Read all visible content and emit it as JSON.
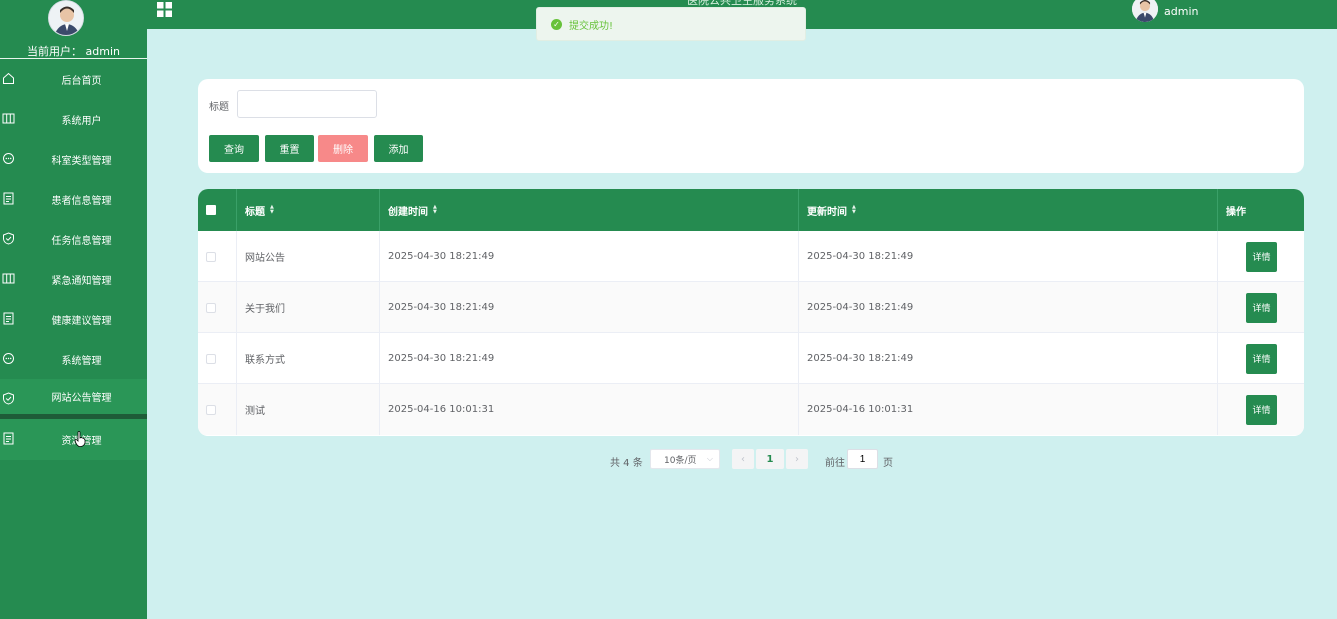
{
  "sidebar": {
    "current_user": "当前用户：  admin",
    "items": [
      {
        "label": "后台首页",
        "icon": "home-icon"
      },
      {
        "label": "系统用户",
        "icon": "columns-icon"
      },
      {
        "label": "科室类型管理",
        "icon": "chat-bubble-icon"
      },
      {
        "label": "患者信息管理",
        "icon": "document-icon"
      },
      {
        "label": "任务信息管理",
        "icon": "shield-icon"
      },
      {
        "label": "紧急通知管理",
        "icon": "columns-icon"
      },
      {
        "label": "健康建议管理",
        "icon": "document-icon"
      },
      {
        "label": "系统管理",
        "icon": "chat-bubble-icon"
      },
      {
        "label": "网站公告管理",
        "icon": "shield-icon"
      },
      {
        "label": "资源管理",
        "icon": "document-icon"
      }
    ]
  },
  "header": {
    "title": "医院公共卫生服务系统",
    "username": "admin"
  },
  "toast": {
    "message": "提交成功!"
  },
  "search": {
    "title_label": "标题",
    "title_value": "",
    "buttons": {
      "query": "查询",
      "reset": "重置",
      "delete": "删除",
      "add": "添加"
    }
  },
  "table": {
    "headers": {
      "title": "标题",
      "created": "创建时间",
      "updated": "更新时间",
      "actions": "操作"
    },
    "detail_label": "详情",
    "rows": [
      {
        "title": "网站公告",
        "created": "2025-04-30 18:21:49",
        "updated": "2025-04-30 18:21:49"
      },
      {
        "title": "关于我们",
        "created": "2025-04-30 18:21:49",
        "updated": "2025-04-30 18:21:49"
      },
      {
        "title": "联系方式",
        "created": "2025-04-30 18:21:49",
        "updated": "2025-04-30 18:21:49"
      },
      {
        "title": "测试",
        "created": "2025-04-16 10:01:31",
        "updated": "2025-04-16 10:01:31"
      }
    ]
  },
  "pagination": {
    "total": "共 4 条",
    "page_size": "10条/页",
    "current_page": "1",
    "goto_label": "前往",
    "goto_value": "1",
    "page_suffix": "页"
  },
  "colors": {
    "primary": "#258b50",
    "background": "#cff0ef",
    "danger": "#f78989",
    "success": "#67c23a"
  }
}
